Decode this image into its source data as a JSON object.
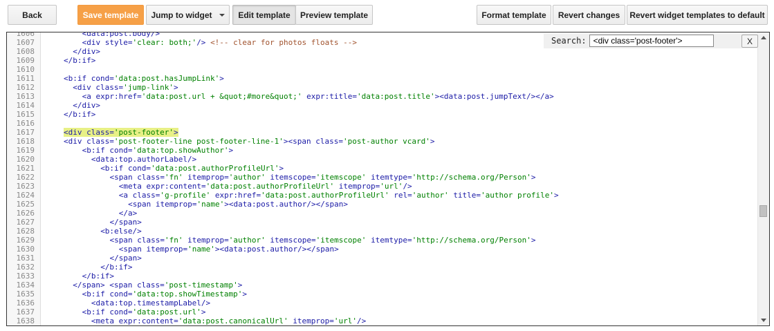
{
  "toolbar": {
    "back_label": "Back",
    "save_label": "Save template",
    "jump_label": "Jump to widget",
    "edit_label": "Edit template",
    "preview_label": "Preview template",
    "format_label": "Format template",
    "revert_label": "Revert changes",
    "revert_widgets_label": "Revert widget templates to default"
  },
  "colors": {
    "save_button": "#f6a047",
    "tag": "#1a1aa6",
    "string": "#008000",
    "comment": "#a0522d",
    "highlight": "#e8f086"
  },
  "search": {
    "label": "Search:",
    "value": "<div class='post-footer'>",
    "close_label": "X"
  },
  "editor": {
    "lines": [
      {
        "n": "1606",
        "indent": 4,
        "hl": false,
        "t": [
          [
            "tg",
            "<data:post.body/>"
          ]
        ]
      },
      {
        "n": "1607",
        "indent": 4,
        "hl": false,
        "t": [
          [
            "tg",
            "<div "
          ],
          [
            "at",
            "style="
          ],
          [
            "st",
            "'clear: both;'"
          ],
          [
            "tg",
            "/> "
          ],
          [
            "cm",
            "<!-- clear for photos floats -->"
          ]
        ]
      },
      {
        "n": "1608",
        "indent": 2,
        "hl": false,
        "t": [
          [
            "tg",
            "</div>"
          ]
        ]
      },
      {
        "n": "1609",
        "indent": 0,
        "hl": false,
        "t": [
          [
            "tg",
            "</b:if>"
          ]
        ]
      },
      {
        "n": "1610",
        "indent": 0,
        "hl": false,
        "t": []
      },
      {
        "n": "1611",
        "indent": 0,
        "hl": false,
        "t": [
          [
            "tg",
            "<b:if "
          ],
          [
            "at",
            "cond="
          ],
          [
            "st",
            "'data:post.hasJumpLink'"
          ],
          [
            "tg",
            ">"
          ]
        ]
      },
      {
        "n": "1612",
        "indent": 2,
        "hl": false,
        "t": [
          [
            "tg",
            "<div "
          ],
          [
            "at",
            "class="
          ],
          [
            "st",
            "'jump-link'"
          ],
          [
            "tg",
            ">"
          ]
        ]
      },
      {
        "n": "1613",
        "indent": 4,
        "hl": false,
        "t": [
          [
            "tg",
            "<a "
          ],
          [
            "at",
            "expr:href="
          ],
          [
            "st",
            "'data:post.url + &quot;#more&quot;'"
          ],
          [
            "tg",
            " "
          ],
          [
            "at",
            "expr:title="
          ],
          [
            "st",
            "'data:post.title'"
          ],
          [
            "tg",
            "><data:post.jumpText/></a>"
          ]
        ]
      },
      {
        "n": "1614",
        "indent": 2,
        "hl": false,
        "t": [
          [
            "tg",
            "</div>"
          ]
        ]
      },
      {
        "n": "1615",
        "indent": 0,
        "hl": false,
        "t": [
          [
            "tg",
            "</b:if>"
          ]
        ]
      },
      {
        "n": "1616",
        "indent": 0,
        "hl": false,
        "t": []
      },
      {
        "n": "1617",
        "indent": 0,
        "hl": true,
        "t": [
          [
            "tg",
            "<div "
          ],
          [
            "at",
            "class="
          ],
          [
            "st",
            "'post-footer'"
          ],
          [
            "tg",
            ">"
          ]
        ]
      },
      {
        "n": "1618",
        "indent": 0,
        "hl": false,
        "t": [
          [
            "tg",
            "<div "
          ],
          [
            "at",
            "class="
          ],
          [
            "st",
            "'post-footer-line post-footer-line-1'"
          ],
          [
            "tg",
            "><span "
          ],
          [
            "at",
            "class="
          ],
          [
            "st",
            "'post-author vcard'"
          ],
          [
            "tg",
            ">"
          ]
        ]
      },
      {
        "n": "1619",
        "indent": 4,
        "hl": false,
        "t": [
          [
            "tg",
            "<b:if "
          ],
          [
            "at",
            "cond="
          ],
          [
            "st",
            "'data:top.showAuthor'"
          ],
          [
            "tg",
            ">"
          ]
        ]
      },
      {
        "n": "1620",
        "indent": 6,
        "hl": false,
        "t": [
          [
            "tg",
            "<data:top.authorLabel/>"
          ]
        ]
      },
      {
        "n": "1621",
        "indent": 8,
        "hl": false,
        "t": [
          [
            "tg",
            "<b:if "
          ],
          [
            "at",
            "cond="
          ],
          [
            "st",
            "'data:post.authorProfileUrl'"
          ],
          [
            "tg",
            ">"
          ]
        ]
      },
      {
        "n": "1622",
        "indent": 10,
        "hl": false,
        "t": [
          [
            "tg",
            "<span "
          ],
          [
            "at",
            "class="
          ],
          [
            "st",
            "'fn'"
          ],
          [
            "tg",
            " "
          ],
          [
            "at",
            "itemprop="
          ],
          [
            "st",
            "'author'"
          ],
          [
            "tg",
            " "
          ],
          [
            "at",
            "itemscope="
          ],
          [
            "st",
            "'itemscope'"
          ],
          [
            "tg",
            " "
          ],
          [
            "at",
            "itemtype="
          ],
          [
            "st",
            "'http://schema.org/Person'"
          ],
          [
            "tg",
            ">"
          ]
        ]
      },
      {
        "n": "1623",
        "indent": 12,
        "hl": false,
        "t": [
          [
            "tg",
            "<meta "
          ],
          [
            "at",
            "expr:content="
          ],
          [
            "st",
            "'data:post.authorProfileUrl'"
          ],
          [
            "tg",
            " "
          ],
          [
            "at",
            "itemprop="
          ],
          [
            "st",
            "'url'"
          ],
          [
            "tg",
            "/>"
          ]
        ]
      },
      {
        "n": "1624",
        "indent": 12,
        "hl": false,
        "t": [
          [
            "tg",
            "<a "
          ],
          [
            "at",
            "class="
          ],
          [
            "st",
            "'g-profile'"
          ],
          [
            "tg",
            " "
          ],
          [
            "at",
            "expr:href="
          ],
          [
            "st",
            "'data:post.authorProfileUrl'"
          ],
          [
            "tg",
            " "
          ],
          [
            "at",
            "rel="
          ],
          [
            "st",
            "'author'"
          ],
          [
            "tg",
            " "
          ],
          [
            "at",
            "title="
          ],
          [
            "st",
            "'author profile'"
          ],
          [
            "tg",
            ">"
          ]
        ]
      },
      {
        "n": "1625",
        "indent": 14,
        "hl": false,
        "t": [
          [
            "tg",
            "<span "
          ],
          [
            "at",
            "itemprop="
          ],
          [
            "st",
            "'name'"
          ],
          [
            "tg",
            "><data:post.author/></span>"
          ]
        ]
      },
      {
        "n": "1626",
        "indent": 12,
        "hl": false,
        "t": [
          [
            "tg",
            "</a>"
          ]
        ]
      },
      {
        "n": "1627",
        "indent": 10,
        "hl": false,
        "t": [
          [
            "tg",
            "</span>"
          ]
        ]
      },
      {
        "n": "1628",
        "indent": 8,
        "hl": false,
        "t": [
          [
            "tg",
            "<b:else/>"
          ]
        ]
      },
      {
        "n": "1629",
        "indent": 10,
        "hl": false,
        "t": [
          [
            "tg",
            "<span "
          ],
          [
            "at",
            "class="
          ],
          [
            "st",
            "'fn'"
          ],
          [
            "tg",
            " "
          ],
          [
            "at",
            "itemprop="
          ],
          [
            "st",
            "'author'"
          ],
          [
            "tg",
            " "
          ],
          [
            "at",
            "itemscope="
          ],
          [
            "st",
            "'itemscope'"
          ],
          [
            "tg",
            " "
          ],
          [
            "at",
            "itemtype="
          ],
          [
            "st",
            "'http://schema.org/Person'"
          ],
          [
            "tg",
            ">"
          ]
        ]
      },
      {
        "n": "1630",
        "indent": 12,
        "hl": false,
        "t": [
          [
            "tg",
            "<span "
          ],
          [
            "at",
            "itemprop="
          ],
          [
            "st",
            "'name'"
          ],
          [
            "tg",
            "><data:post.author/></span>"
          ]
        ]
      },
      {
        "n": "1631",
        "indent": 10,
        "hl": false,
        "t": [
          [
            "tg",
            "</span>"
          ]
        ]
      },
      {
        "n": "1632",
        "indent": 8,
        "hl": false,
        "t": [
          [
            "tg",
            "</b:if>"
          ]
        ]
      },
      {
        "n": "1633",
        "indent": 4,
        "hl": false,
        "t": [
          [
            "tg",
            "</b:if>"
          ]
        ]
      },
      {
        "n": "1634",
        "indent": 2,
        "hl": false,
        "t": [
          [
            "tg",
            "</span> <span "
          ],
          [
            "at",
            "class="
          ],
          [
            "st",
            "'post-timestamp'"
          ],
          [
            "tg",
            ">"
          ]
        ]
      },
      {
        "n": "1635",
        "indent": 4,
        "hl": false,
        "t": [
          [
            "tg",
            "<b:if "
          ],
          [
            "at",
            "cond="
          ],
          [
            "st",
            "'data:top.showTimestamp'"
          ],
          [
            "tg",
            ">"
          ]
        ]
      },
      {
        "n": "1636",
        "indent": 6,
        "hl": false,
        "t": [
          [
            "tg",
            "<data:top.timestampLabel/>"
          ]
        ]
      },
      {
        "n": "1637",
        "indent": 4,
        "hl": false,
        "t": [
          [
            "tg",
            "<b:if "
          ],
          [
            "at",
            "cond="
          ],
          [
            "st",
            "'data:post.url'"
          ],
          [
            "tg",
            ">"
          ]
        ]
      },
      {
        "n": "1638",
        "indent": 6,
        "hl": false,
        "t": [
          [
            "tg",
            "<meta "
          ],
          [
            "at",
            "expr:content="
          ],
          [
            "st",
            "'data:post.canonicalUrl'"
          ],
          [
            "tg",
            " "
          ],
          [
            "at",
            "itemprop="
          ],
          [
            "st",
            "'url'"
          ],
          [
            "tg",
            "/>"
          ]
        ]
      }
    ]
  }
}
